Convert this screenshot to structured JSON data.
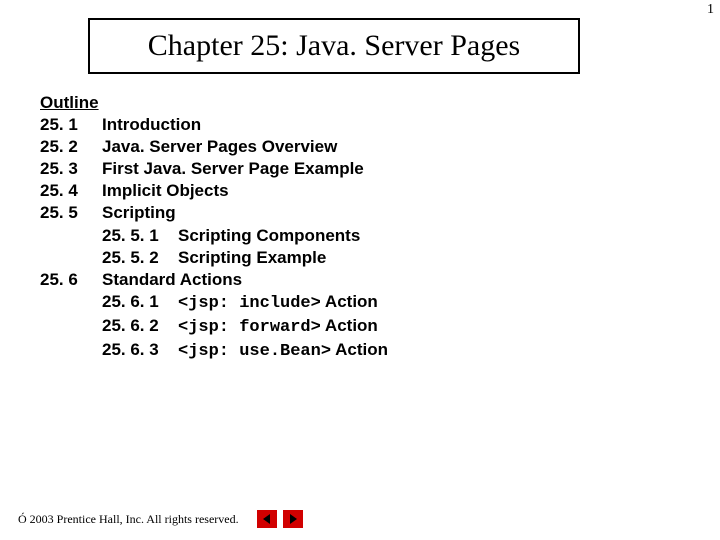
{
  "page_number": "1",
  "title": "Chapter 25: Java. Server Pages",
  "outline": {
    "header": "Outline",
    "rows": [
      {
        "num": "25. 1",
        "title": "Introduction"
      },
      {
        "num": "25. 2",
        "title": "Java. Server Pages Overview"
      },
      {
        "num": "25. 3",
        "title": "First Java. Server Page Example"
      },
      {
        "num": "25. 4",
        "title": "Implicit Objects"
      },
      {
        "num": "25. 5",
        "title": "Scripting"
      }
    ],
    "subs_5": [
      {
        "num": "25. 5. 1",
        "title": "Scripting Components"
      },
      {
        "num": "25. 5. 2",
        "title": "Scripting Example"
      }
    ],
    "row6": {
      "num": "25. 6",
      "title": "Standard Actions"
    },
    "subs_6": [
      {
        "num": "25. 6. 1",
        "code": "<jsp: include>",
        "tail": " Action"
      },
      {
        "num": "25. 6. 2",
        "code": "<jsp: forward>",
        "tail": " Action"
      },
      {
        "num": "25. 6. 3",
        "code_a": "<jsp: use.",
        "code_b": "Bean>",
        "tail": " Action"
      }
    ]
  },
  "footer": {
    "copyright_symbol": "Ó",
    "text": " 2003 Prentice Hall, Inc. All rights reserved."
  }
}
